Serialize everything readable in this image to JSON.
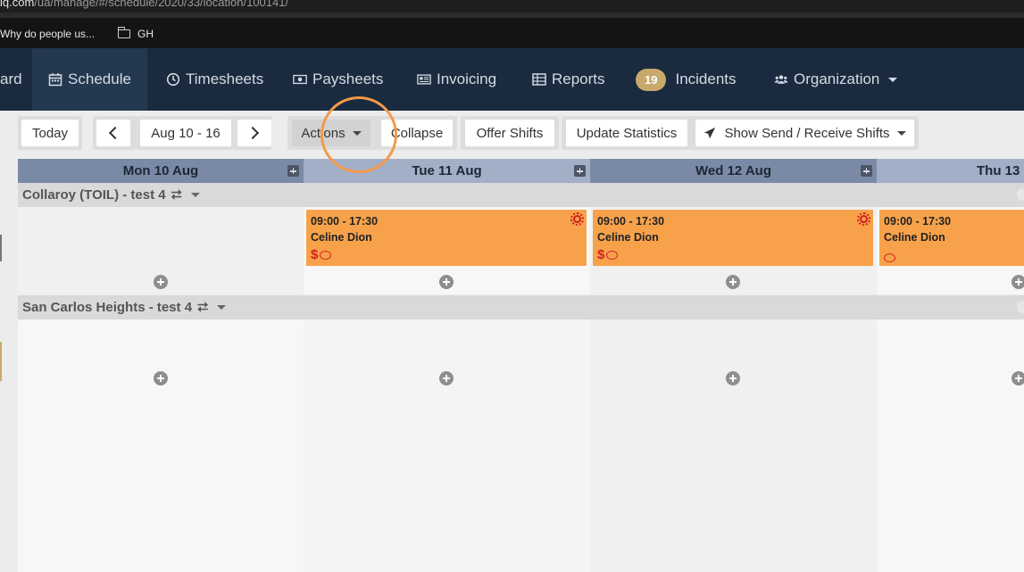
{
  "browser": {
    "url_domain": "iq.com",
    "url_path": "/ua/manage/#/schedule/2020/33/location/100141/",
    "bookmarks": [
      {
        "label": "Why do people us..."
      },
      {
        "label": "GH",
        "icon": "folder-icon"
      }
    ]
  },
  "nav": {
    "items": [
      {
        "label": "ard",
        "icon": ""
      },
      {
        "label": "Schedule",
        "icon": "calendar-icon",
        "active": true
      },
      {
        "label": "Timesheets",
        "icon": "clock-icon"
      },
      {
        "label": "Paysheets",
        "icon": "money-icon"
      },
      {
        "label": "Invoicing",
        "icon": "newspaper-icon"
      },
      {
        "label": "Reports",
        "icon": "table-icon"
      },
      {
        "label": "Incidents",
        "badge": "19"
      },
      {
        "label": "Organization",
        "icon": "users-icon",
        "dropdown": true
      }
    ],
    "badge_color": "#c9a96b"
  },
  "toolbar": {
    "today": "Today",
    "date_range": "Aug 10 - 16",
    "actions": "Actions",
    "collapse": "Collapse",
    "offer_shifts": "Offer Shifts",
    "update_statistics": "Update Statistics",
    "send_receive": "Show Send / Receive Shifts"
  },
  "calendar": {
    "days": [
      {
        "label": "Mon 10 Aug"
      },
      {
        "label": "Tue 11 Aug"
      },
      {
        "label": "Wed 12 Aug"
      },
      {
        "label": "Thu 13"
      }
    ],
    "locations": [
      {
        "name": "Collaroy (TOIL) - test 4"
      },
      {
        "name": "San Carlos Heights - test 4"
      }
    ],
    "shifts": [
      {
        "time": "09:00 - 17:30",
        "name": "Celine Dion",
        "dollar": "$"
      },
      {
        "time": "09:00 - 17:30",
        "name": "Celine Dion",
        "dollar": "$"
      },
      {
        "time": "09:00 - 17:30",
        "name": "Celine Dion",
        "dollar": ""
      }
    ],
    "shift_color": "#f7a24b",
    "alert_color": "#d31f1f"
  }
}
